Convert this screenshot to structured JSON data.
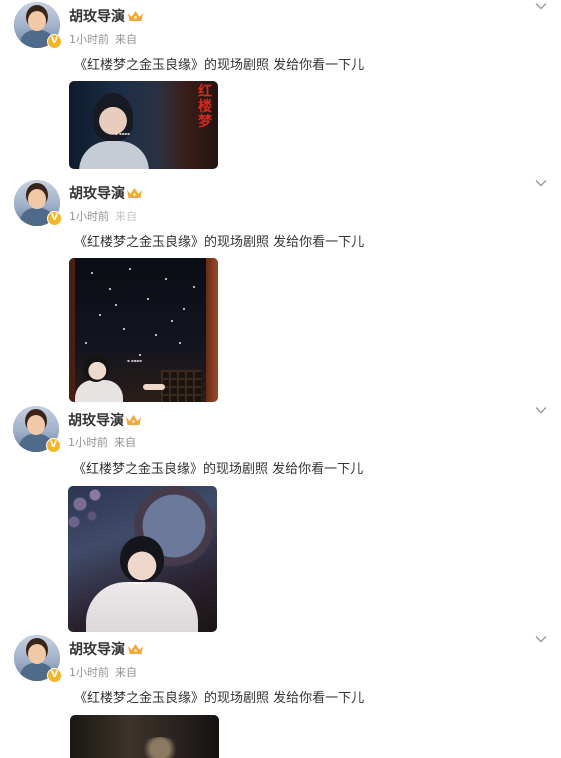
{
  "posts": [
    {
      "author": "胡玫导演",
      "time": "1小时前",
      "source": "来自",
      "text": "《红楼梦之金玉良缘》的现场剧照 发给你看一下儿",
      "verified_badge": "V",
      "crown_icon": "crown-icon",
      "expand_icon": "chevron-down-icon",
      "photo_title": "红楼梦"
    },
    {
      "author": "胡玫导演",
      "time": "1小时前",
      "source": "来自",
      "text": "《红楼梦之金玉良缘》的现场剧照 发给你看一下儿",
      "verified_badge": "V",
      "crown_icon": "crown-icon",
      "expand_icon": "chevron-down-icon"
    },
    {
      "author": "胡玫导演",
      "time": "1小时前",
      "source": "来自",
      "text": "《红楼梦之金玉良缘》的现场剧照 发给你看一下儿",
      "verified_badge": "V",
      "crown_icon": "crown-icon",
      "expand_icon": "chevron-down-icon"
    },
    {
      "author": "胡玫导演",
      "time": "1小时前",
      "source": "来自",
      "text": "《红楼梦之金玉良缘》的现场剧照 发给你看一下儿",
      "verified_badge": "V",
      "crown_icon": "crown-icon",
      "expand_icon": "chevron-down-icon"
    }
  ],
  "colors": {
    "name": "#333333",
    "meta": "#939393",
    "verified": "#f6b624",
    "crown": "#f2a93b"
  }
}
